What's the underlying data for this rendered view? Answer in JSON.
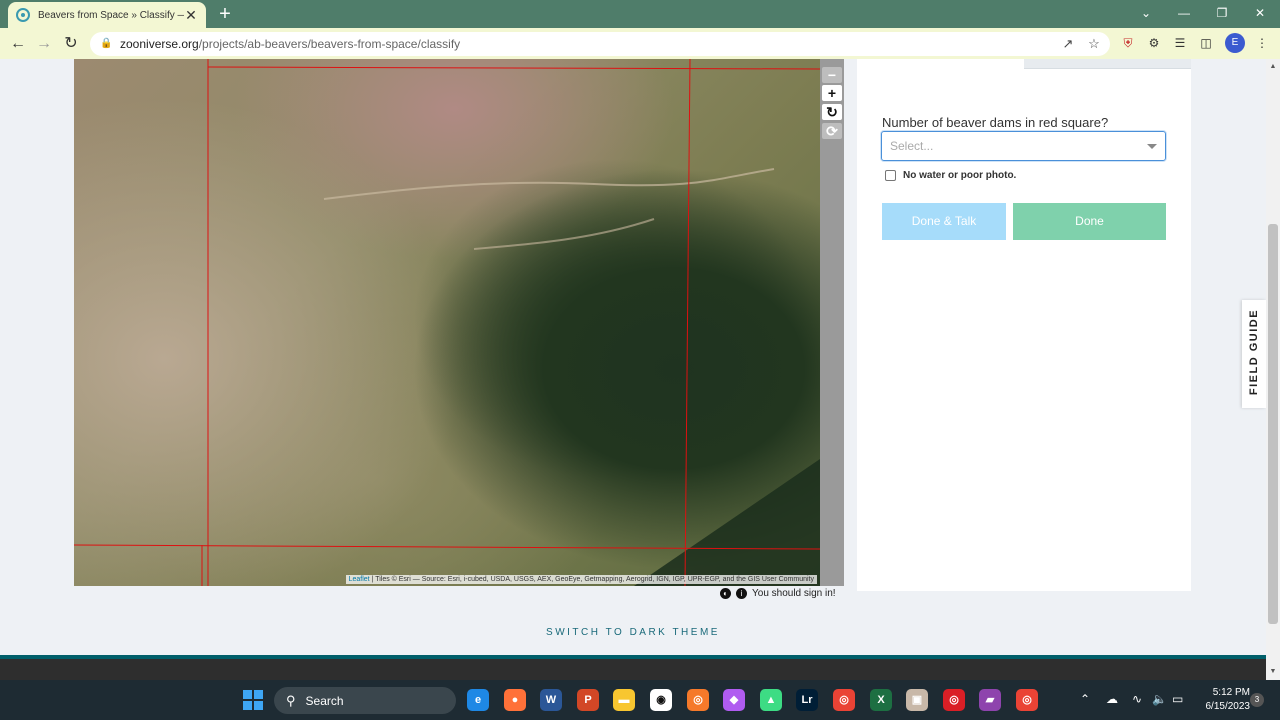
{
  "browser": {
    "tab_title": "Beavers from Space » Classify —",
    "tab_close": "✕",
    "new_tab": "+",
    "url_host": "zooniverse.org",
    "url_path": "/projects/ab-beavers/beavers-from-space/classify",
    "back": "←",
    "forward": "→",
    "reload": "↻",
    "profile_initial": "E",
    "window_minimize": "—",
    "window_restore": "❐",
    "window_close": "✕",
    "tab_list": "⌄"
  },
  "map": {
    "controls": {
      "minus": "−",
      "plus": "+",
      "rotate": "↻",
      "reset": "⟳"
    },
    "attribution_link": "Leaflet",
    "attribution_text": " | Tiles © Esri — Source: Esri, i-cubed, USDA, USGS, AEX, GeoEye, Getmapping, Aerogrid, IGN, IGP, UPR-EGP, and the GIS User Community"
  },
  "task": {
    "question": "Number of beaver dams in red square?",
    "select_placeholder": "Select...",
    "checkbox_label": "No water or poor photo.",
    "done_talk_label": "Done & Talk",
    "done_label": "Done"
  },
  "footer": {
    "signin_text": "You should sign in!",
    "dark_theme_link": "SWITCH TO DARK THEME"
  },
  "field_guide": {
    "label": "FIELD GUIDE"
  },
  "taskbar": {
    "search_label": "Search",
    "time": "5:12 PM",
    "date": "6/15/2023",
    "notification_count": "3",
    "apps": [
      {
        "name": "edge",
        "glyph": "e",
        "color": "#1e88e5"
      },
      {
        "name": "firefox",
        "glyph": "●",
        "color": "#ff7139"
      },
      {
        "name": "word",
        "glyph": "W",
        "color": "#2b5797"
      },
      {
        "name": "powerpoint",
        "glyph": "P",
        "color": "#d24726"
      },
      {
        "name": "file-explorer",
        "glyph": "▬",
        "color": "#f8c630"
      },
      {
        "name": "penguin-app",
        "glyph": "◉",
        "color": "#ffffff"
      },
      {
        "name": "blender",
        "glyph": "◎",
        "color": "#f5792a"
      },
      {
        "name": "paint-drop",
        "glyph": "◆",
        "color": "#b05cf0"
      },
      {
        "name": "android-studio",
        "glyph": "▲",
        "color": "#3ddc84"
      },
      {
        "name": "lightroom",
        "glyph": "Lr",
        "color": "#001e36"
      },
      {
        "name": "chrome",
        "glyph": "◎",
        "color": "#ea4335"
      },
      {
        "name": "excel",
        "glyph": "X",
        "color": "#1d6f42"
      },
      {
        "name": "photo-app",
        "glyph": "▣",
        "color": "#c8b8a8"
      },
      {
        "name": "creative-cloud",
        "glyph": "◎",
        "color": "#da1f26"
      },
      {
        "name": "video-editor",
        "glyph": "▰",
        "color": "#8e44ad"
      },
      {
        "name": "chrome-profile",
        "glyph": "◎",
        "color": "#ea4335"
      }
    ]
  }
}
